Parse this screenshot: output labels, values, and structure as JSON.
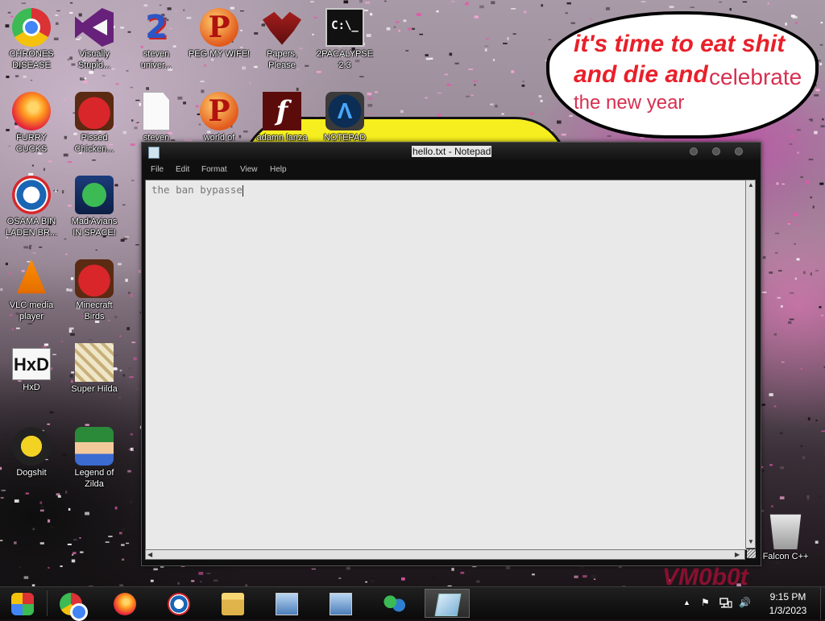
{
  "desktop": {
    "speech_bubble": {
      "line1": "it's time to eat shit",
      "line2": "and die and",
      "line2b": "celebrate",
      "line3": "the new year"
    },
    "wallpaper_text": "VM0b0t",
    "icons": {
      "chrome": "CHRONES\nDISEASE",
      "visual_studio": "Visually\nStupid...",
      "steven_universe": "steven\nuniver...",
      "peg_my_wife": "PEG MY WIFE!",
      "papers_please": "Papers,\nPlease",
      "twopacalypse": "2PACALYPSE\n2.3",
      "firefox": "FURRY CUCKS",
      "pissed_chickens": "Pissed\nChicken...",
      "steven_file": "steven",
      "world_of": "world of",
      "adamn_lanza": "adamn lanza",
      "notepad_pp": "NOTEPAD",
      "osama": "OSAMA BIN\nLADEN BR...",
      "mad_avians": "Mad Avians\nIN SPACE!",
      "vlc": "VLC media\nplayer",
      "minecraft_birds": "Minecraft\nBirds",
      "hxd": "HxD",
      "super_hilda": "Super Hilda",
      "dogshit": "Dogshit",
      "legend_zilda": "Legend of\nZilda",
      "falcon": "Falcon C++"
    }
  },
  "notepad": {
    "title": "hello.txt - Notepad",
    "menu": [
      "File",
      "Edit",
      "Format",
      "View",
      "Help"
    ],
    "content": "the ban bypasse"
  },
  "taskbar": {
    "clock_time": "9:15 PM",
    "clock_date": "1/3/2023",
    "tray_chevron": "▲",
    "tray_flag": "⚑",
    "tray_volume": "🔊"
  }
}
